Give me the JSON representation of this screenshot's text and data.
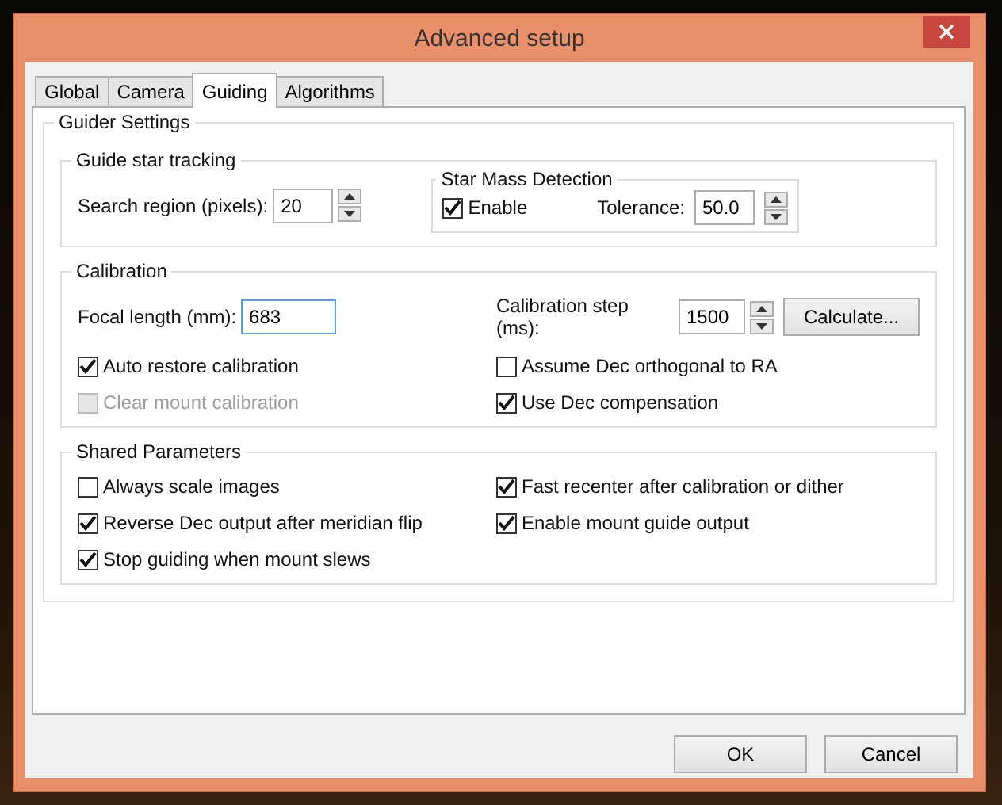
{
  "window": {
    "title": "Advanced setup"
  },
  "tabs": [
    {
      "label": "Global",
      "selected": false
    },
    {
      "label": "Camera",
      "selected": false
    },
    {
      "label": "Guiding",
      "selected": true
    },
    {
      "label": "Algorithms",
      "selected": false
    }
  ],
  "guider_settings": {
    "title": "Guider Settings",
    "tracking": {
      "title": "Guide star tracking",
      "search_region": {
        "label": "Search region (pixels):",
        "value": "20"
      },
      "star_mass": {
        "title": "Star Mass Detection",
        "enable": {
          "label": "Enable",
          "checked": true
        },
        "tolerance": {
          "label": "Tolerance:",
          "value": "50.0"
        }
      }
    },
    "calibration": {
      "title": "Calibration",
      "focal_length": {
        "label": "Focal length (mm):",
        "value": "683",
        "focused": true
      },
      "step": {
        "label": "Calibration step (ms):",
        "value": "1500"
      },
      "calculate_button": "Calculate...",
      "checkboxes": [
        {
          "label": "Auto restore calibration",
          "checked": true,
          "disabled": false
        },
        {
          "label": "Assume Dec orthogonal to RA",
          "checked": false,
          "disabled": false
        },
        {
          "label": "Clear mount calibration",
          "checked": false,
          "disabled": true
        },
        {
          "label": "Use Dec compensation",
          "checked": true,
          "disabled": false
        }
      ]
    },
    "shared": {
      "title": "Shared Parameters",
      "checkboxes": [
        {
          "label": "Always scale images",
          "checked": false,
          "disabled": false
        },
        {
          "label": "Fast recenter after calibration or dither",
          "checked": true,
          "disabled": false
        },
        {
          "label": "Reverse Dec output after meridian flip",
          "checked": true,
          "disabled": false
        },
        {
          "label": "Enable mount guide output",
          "checked": true,
          "disabled": false
        },
        {
          "label": "Stop guiding when mount slews",
          "checked": true,
          "disabled": false
        }
      ]
    }
  },
  "buttons": [
    "OK",
    "Cancel"
  ]
}
